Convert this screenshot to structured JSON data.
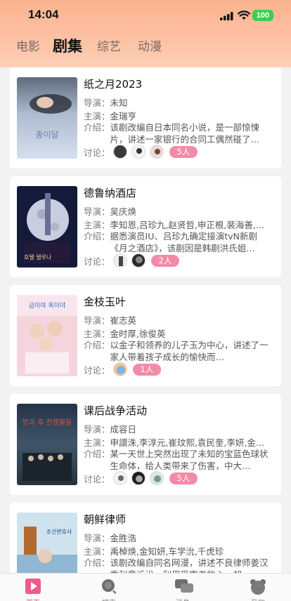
{
  "status_bar": {
    "time": "14:04",
    "battery": "100"
  },
  "tabs": [
    {
      "label": "电影",
      "active": false
    },
    {
      "label": "剧集",
      "active": true
    },
    {
      "label": "综艺",
      "active": false
    },
    {
      "label": "动漫",
      "active": false
    }
  ],
  "labels": {
    "director": "导演：",
    "cast": "主演：",
    "intro": "介绍：",
    "discuss": "讨论："
  },
  "shows": [
    {
      "title": "纸之月2023",
      "director": "未知",
      "cast": "金瑞亨",
      "intro": "该剧改编自日本同名小说，是一部惊悚片，讲述一家银行的合同工偶然碰了…",
      "discuss_count": "5人",
      "poster_text": "종이달"
    },
    {
      "title": "德鲁纳酒店",
      "director": "吴庆焕",
      "cast": "李知恩,吕珍九,赵贤哲,申正根,裴海善,…",
      "intro": "据悉演员IU、吕珍九确定接演tvN新剧《月之酒店》，该剧因是韩剧洪氏姐…",
      "discuss_count": "2人",
      "poster_text": "호텔 델루나"
    },
    {
      "title": "金枝玉叶",
      "director": "崔志英",
      "cast": "金时厚,徐俊英",
      "intro": "以金子和领养的儿子玉为中心，讲述了一家人带着孩子成长的愉快而…",
      "discuss_count": "1人",
      "poster_text": "금이야 옥이야"
    },
    {
      "title": "课后战争活动",
      "director": "成容日",
      "cast": "申譞洙,李淳元,崔玟熙,袁民奎,李妍,金…",
      "intro": "某一天世上突然出现了未知的宝蓝色球状生命体，给人类带来了伤害，中大…",
      "discuss_count": "5人",
      "poster_text": "방과 후 전쟁활동"
    },
    {
      "title": "朝鲜律师",
      "director": "金胜浩",
      "cast": "禹棹焕,金知妍,车学沇,千虎珍",
      "intro": "该剧改编自同名网漫，讲述不良律师姜汉秀利章诉讼，利用受害者的心，却…",
      "discuss_count": "",
      "poster_text": "조선변호사"
    }
  ],
  "bottom_nav": [
    {
      "label": "首页",
      "icon": "play-icon",
      "active": true
    },
    {
      "label": "搜索",
      "icon": "search-icon",
      "active": false
    },
    {
      "label": "消息",
      "icon": "chat-icon",
      "active": false
    },
    {
      "label": "我的",
      "icon": "bear-icon",
      "active": false
    }
  ],
  "colors": {
    "header_gradient_top": "#fbb38f",
    "accent_pink": "#ee5c8a",
    "badge_pink": "#f48aa6",
    "battery_green": "#3ccf4e"
  }
}
